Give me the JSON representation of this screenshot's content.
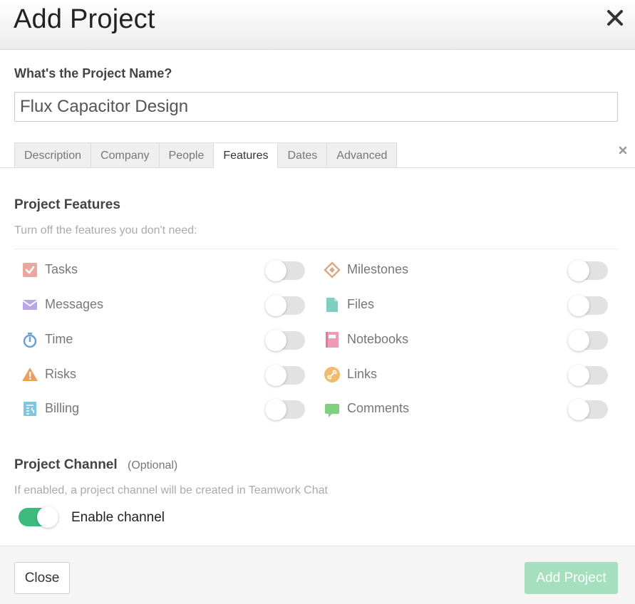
{
  "header": {
    "title": "Add Project"
  },
  "project_name": {
    "label": "What's the Project Name?",
    "value": "Flux Capacitor Design"
  },
  "tabs": [
    {
      "label": "Description",
      "active": false
    },
    {
      "label": "Company",
      "active": false
    },
    {
      "label": "People",
      "active": false
    },
    {
      "label": "Features",
      "active": true
    },
    {
      "label": "Dates",
      "active": false
    },
    {
      "label": "Advanced",
      "active": false
    }
  ],
  "features_section": {
    "title": "Project Features",
    "subtitle": "Turn off the features you don't need:",
    "left": [
      {
        "label": "Tasks",
        "icon": "tasks-icon",
        "color": "#e8a79f",
        "enabled": false
      },
      {
        "label": "Messages",
        "icon": "messages-icon",
        "color": "#b9a6e8",
        "enabled": false
      },
      {
        "label": "Time",
        "icon": "time-icon",
        "color": "#6a9fd8",
        "enabled": false
      },
      {
        "label": "Risks",
        "icon": "risks-icon",
        "color": "#e9a05a",
        "enabled": false
      },
      {
        "label": "Billing",
        "icon": "billing-icon",
        "color": "#7fc7e0",
        "enabled": false
      }
    ],
    "right": [
      {
        "label": "Milestones",
        "icon": "milestones-icon",
        "color": "#d9aa8a",
        "enabled": false
      },
      {
        "label": "Files",
        "icon": "files-icon",
        "color": "#7ecfbf",
        "enabled": false
      },
      {
        "label": "Notebooks",
        "icon": "notebooks-icon",
        "color": "#ef9bb5",
        "enabled": false
      },
      {
        "label": "Links",
        "icon": "links-icon",
        "color": "#f0bb6b",
        "enabled": false
      },
      {
        "label": "Comments",
        "icon": "comments-icon",
        "color": "#7fd07f",
        "enabled": false
      }
    ]
  },
  "channel": {
    "title": "Project Channel",
    "optional": "(Optional)",
    "description": "If enabled, a project channel will be created in Teamwork Chat",
    "toggle_label": "Enable channel",
    "enabled": true
  },
  "footer": {
    "close_label": "Close",
    "add_label": "Add Project"
  }
}
